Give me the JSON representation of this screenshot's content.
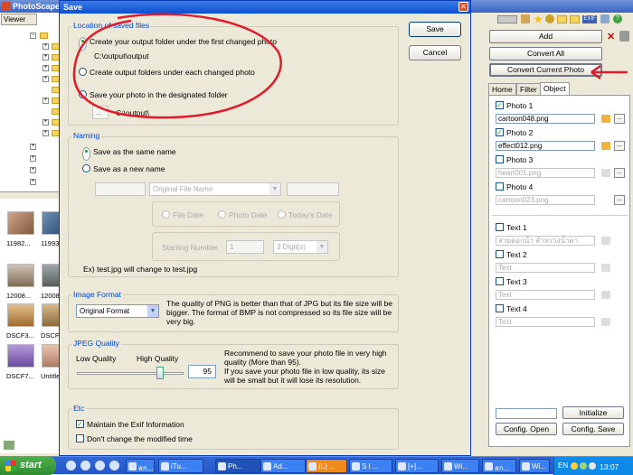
{
  "app": {
    "title": "PhotoScape"
  },
  "left": {
    "viewer_tab": "Viewer",
    "thumbs": [
      "11982...",
      "11993...",
      "12008...",
      "12008...",
      "DSCF3...",
      "DSCF6...",
      "DSCF7...",
      "Untitle..."
    ]
  },
  "dialog": {
    "title": "Save",
    "save_button": "Save",
    "cancel_button": "Cancel",
    "location": {
      "legend": "Location of saved files",
      "opt1": "Create your output folder under the first changed photo",
      "opt1_path": "C:\\output\\output",
      "opt2": "Create output folders under each changed photo",
      "opt3": "Save your photo in the designated folder",
      "browse": "...",
      "opt3_path": "C:\\output\\"
    },
    "naming": {
      "legend": "Naming",
      "same": "Save as the same name",
      "new": "Save as a new name",
      "original_file_name": "Original File Name",
      "file_date": "File Date",
      "photo_date": "Photo Date",
      "todays_date": "Today's Date",
      "starting_number_label": "Starting Number",
      "starting_number": "1",
      "digits": "3 Digit(s)",
      "example": "Ex) test.jpg will change to test.jpg"
    },
    "format": {
      "legend": "Image Format",
      "selected": "Original Format",
      "note": "The quality of PNG is better than that of JPG but its file size will be bigger. The format of BMP is not compressed so its file size will be very big."
    },
    "jpeg": {
      "legend": "JPEG Quality",
      "low": "Low Quality",
      "high": "High Quality",
      "value": "95",
      "note": "Recommend to save your photo file in very high quality (More than 95).\nIf you save your photo file in low quality, its size will be small but it will lose its resolution."
    },
    "etc": {
      "legend": "Etc",
      "exif": "Maintain the Exif Information",
      "modified": "Don't change the modified time"
    }
  },
  "right": {
    "add": "Add",
    "convert_all": "Convert All",
    "convert_current": "Convert Current Photo",
    "tabs": [
      "Home",
      "Filter",
      "Object"
    ],
    "photos": [
      {
        "label": "Photo 1",
        "file": "cartoon048.png"
      },
      {
        "label": "Photo 2",
        "file": "effect012.png"
      },
      {
        "label": "Photo 3",
        "file": "heart001.png"
      },
      {
        "label": "Photo 4",
        "file": "cartoon023.png"
      }
    ],
    "texts": [
      {
        "label": "Text 1",
        "value": "สวยดอกน้ำ สำหรางน้ำตา"
      },
      {
        "label": "Text 2",
        "value": "Text"
      },
      {
        "label": "Text 3",
        "value": "Text"
      },
      {
        "label": "Text 4",
        "value": "Text"
      }
    ],
    "initialize": "Initialize",
    "config_open": "Config. Open",
    "config_save": "Config. Save"
  },
  "taskbar": {
    "start": "start",
    "buttons": [
      "สก...",
      "iTu...",
      "Ph...",
      "Ad...",
      "(L) ...",
      "S l ...",
      "[+]...",
      "Wi...",
      "สก...",
      "Wi..."
    ],
    "lang": "EN",
    "clock": "13:07"
  }
}
